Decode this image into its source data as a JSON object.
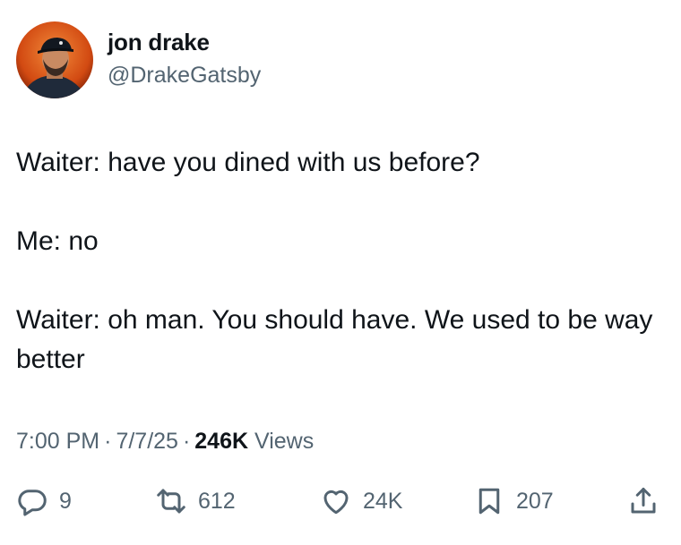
{
  "author": {
    "display_name": "jon drake",
    "handle": "@DrakeGatsby",
    "avatar_icon": "profile-photo"
  },
  "tweet": {
    "paragraphs": [
      "Waiter: have you dined with us before?",
      "Me: no",
      "Waiter: oh man. You should have. We used to be way better"
    ]
  },
  "meta": {
    "time": "7:00 PM",
    "separator": "·",
    "date": "7/7/25",
    "views_count": "246K",
    "views_label": "Views"
  },
  "actions": {
    "replies": "9",
    "reposts": "612",
    "likes": "24K",
    "bookmarks": "207",
    "icons": [
      "reply-icon",
      "repost-icon",
      "like-icon",
      "bookmark-icon",
      "share-icon"
    ]
  },
  "colors": {
    "text": "#0f1419",
    "secondary": "#536471",
    "background": "#ffffff"
  }
}
